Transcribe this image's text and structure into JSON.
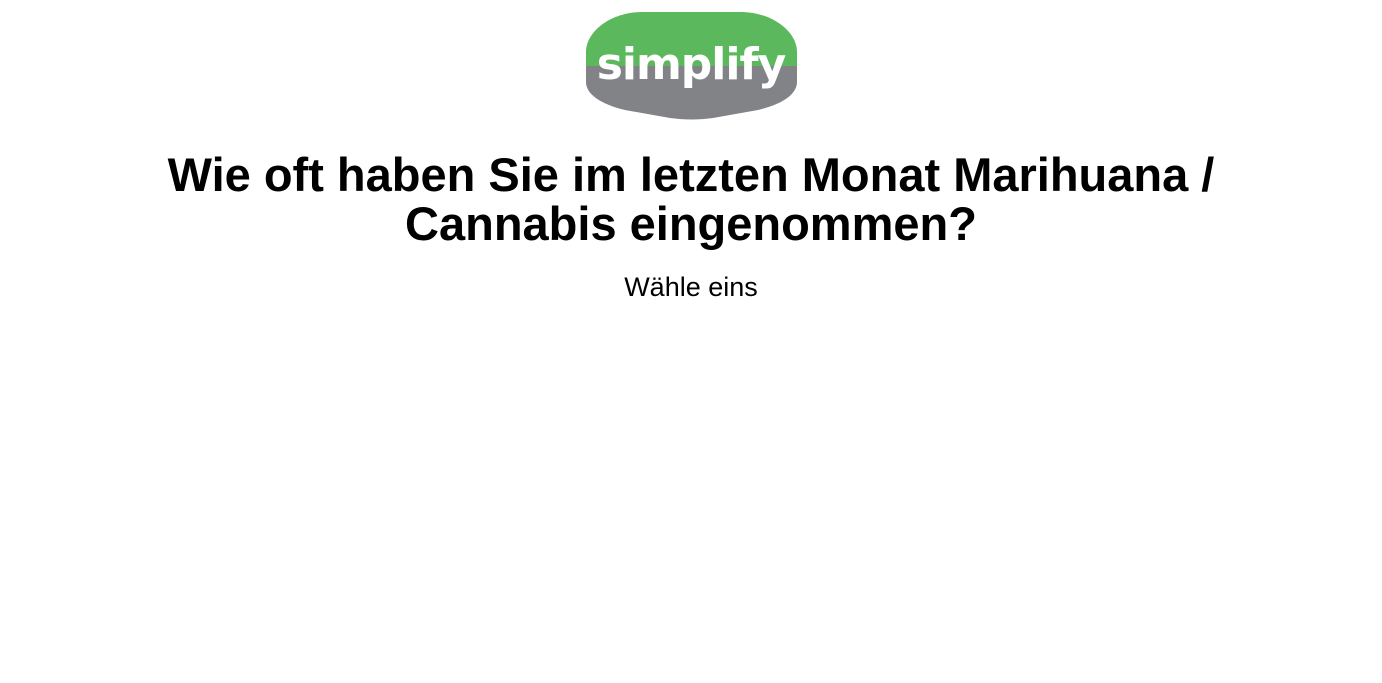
{
  "logo": {
    "text": "simplify",
    "colors": {
      "top": "#5cb85c",
      "bottom": "#828387",
      "text": "#ffffff"
    }
  },
  "question": {
    "line1": "Wie oft haben Sie im letzten Monat Marihuana /",
    "line2": "Cannabis eingenommen?"
  },
  "hint": "Wähle eins",
  "colors": {
    "background": "#ffffff",
    "text": "#000000"
  }
}
